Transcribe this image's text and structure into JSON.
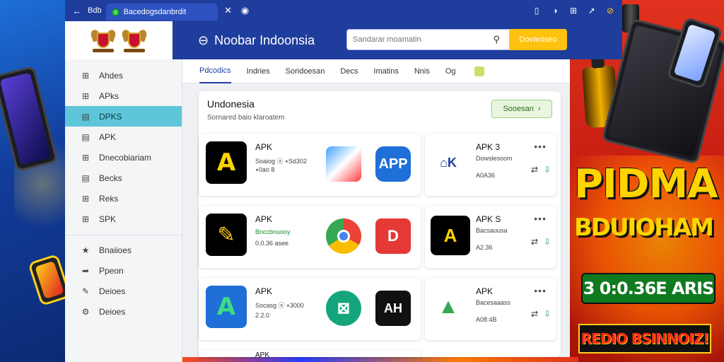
{
  "browser": {
    "back_label": "Bdb",
    "tab_title": "Bacedogsdanbrdit",
    "icons": [
      "back-arrow-icon",
      "close-icon",
      "shield-icon",
      "bookmark-icon",
      "profile-icon",
      "extensions-icon",
      "share-icon",
      "alert-icon"
    ]
  },
  "header": {
    "brand": "Noobar Indoonsia",
    "search": {
      "placeholder": "Sandarar moamatin",
      "button": "Dovaroseo"
    }
  },
  "sidebar": {
    "items": [
      {
        "icon": "grid-icon",
        "label": "Ahdes"
      },
      {
        "icon": "grid-icon",
        "label": "APks"
      },
      {
        "icon": "list-icon",
        "label": "DPKS",
        "active": true
      },
      {
        "icon": "list-icon",
        "label": "APK"
      },
      {
        "icon": "grid-icon",
        "label": "Dnecobiariam"
      },
      {
        "icon": "list-icon",
        "label": "Becks"
      },
      {
        "icon": "grid-icon",
        "label": "Reks"
      },
      {
        "icon": "grid-icon",
        "label": "SPK"
      }
    ],
    "group": [
      {
        "icon": "star-icon",
        "label": "Bnaiioes"
      },
      {
        "icon": "arrow-icon",
        "label": "Ppeon"
      },
      {
        "icon": "pencil-icon",
        "label": "Deioes"
      },
      {
        "icon": "gear-icon",
        "label": "Deioes"
      }
    ]
  },
  "topnav": [
    "Pdcodics",
    "Indries",
    "Soridoesan",
    "Decs",
    "Imatins",
    "Nnis",
    "Og"
  ],
  "panel": {
    "title": "Undonesia",
    "subtitle": "Sornared baio klaroatem",
    "button": "Sooesan"
  },
  "cards": [
    {
      "name": "APK",
      "meta1": "Soaiog ⓐ ⭑Sd302",
      "meta2": "⭑0ao 8",
      "side_name": "APK 3",
      "side_meta1": "Dowslesoom",
      "side_meta2": "A0A36"
    },
    {
      "name": "APK",
      "meta1": "Bnccbnuooy",
      "meta2": "0.0.36 asee",
      "side_name": "APK S",
      "side_meta1": "Bacsauusa",
      "side_meta2": "A2.36"
    },
    {
      "name": "APK",
      "meta1": "Socasg ⓐ ⭑3000",
      "meta2": "2.2.0",
      "side_name": "APK",
      "side_meta1": "Bacesaaass",
      "side_meta2": "A08:4B"
    }
  ],
  "card_partial": {
    "name": "APK"
  },
  "promo": {
    "title": "PIDMA",
    "subtitle": "BDUIOHAM",
    "badge": "3 0:0.36E ARIS",
    "ribbon": "REDIO BSINNOIZ!"
  },
  "colors": {
    "brand_blue": "#1f3d9c",
    "accent_yellow": "#ffc20e",
    "active_teal": "#5ec6d8",
    "promo_red": "#e0321e"
  }
}
